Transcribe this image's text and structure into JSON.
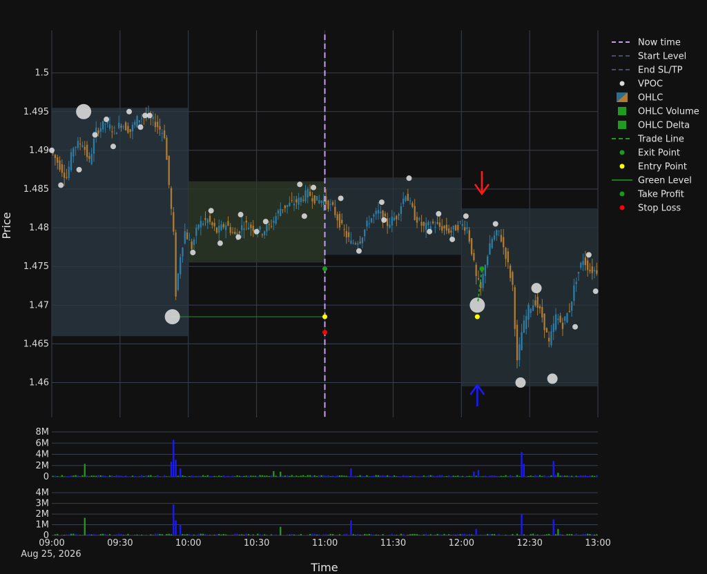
{
  "chart_data": {
    "type": "candlestick",
    "xlabel": "Time",
    "ylabel": "Price",
    "x_ticks": [
      "09:00",
      "09:30",
      "10:00",
      "10:30",
      "11:00",
      "11:30",
      "12:00",
      "12:30",
      "13:00"
    ],
    "x_date_label": "Aug 25, 2026",
    "x_range": [
      "09:00",
      "13:00"
    ],
    "price_ylim": [
      1.4555,
      1.5055
    ],
    "price_ticks": [
      "1.46",
      "1.465",
      "1.47",
      "1.475",
      "1.48",
      "1.485",
      "1.49",
      "1.495",
      "1.5"
    ],
    "volume_ticks": [
      "0",
      "2M",
      "4M",
      "6M",
      "8M"
    ],
    "volume_ylim": [
      0,
      8500000
    ],
    "delta_ticks": [
      "0",
      "1M",
      "2M",
      "3M",
      "4M"
    ],
    "delta_ylim": [
      0,
      4400000
    ],
    "now_time": "11:00",
    "legend": [
      {
        "label": "Now time",
        "kind": "dash-line",
        "color": "#c9a0f0"
      },
      {
        "label": "Start Level",
        "kind": "dash-line",
        "color": "#4b4f66"
      },
      {
        "label": "End SL/TP",
        "kind": "dash-line",
        "color": "#4b4f66"
      },
      {
        "label": "VPOC",
        "kind": "dot",
        "color": "#d9d9d9"
      },
      {
        "label": "OHLC",
        "kind": "ohlc",
        "color": "#2e6d8e"
      },
      {
        "label": "OHLC Volume",
        "kind": "square",
        "color": "#1f9b1f"
      },
      {
        "label": "OHLC Delta",
        "kind": "square",
        "color": "#1f9b1f"
      },
      {
        "label": "Trade Line",
        "kind": "dash-line",
        "color": "#1f9b1f"
      },
      {
        "label": "Exit Point",
        "kind": "dot",
        "color": "#1a9a1a"
      },
      {
        "label": "Entry Point",
        "kind": "dot",
        "color": "#ffff00"
      },
      {
        "label": "Green Level",
        "kind": "line",
        "color": "#1aa01a"
      },
      {
        "label": "Take Profit",
        "kind": "dot",
        "color": "#1a9a1a"
      },
      {
        "label": "Stop Loss",
        "kind": "dot",
        "color": "#ff0000"
      }
    ],
    "sessions": [
      {
        "start": "09:00",
        "end": "10:00",
        "low": 1.466,
        "high": 1.4955,
        "color": "#2b3a44"
      },
      {
        "start": "10:00",
        "end": "11:00",
        "low": 1.4755,
        "high": 1.486,
        "color": "#2d3b2a"
      },
      {
        "start": "11:00",
        "end": "12:00",
        "low": 1.4765,
        "high": 1.4865,
        "color": "#28343b"
      },
      {
        "start": "12:00",
        "end": "13:00",
        "low": 1.4595,
        "high": 1.4825,
        "color": "#28343b"
      }
    ],
    "price_path": [
      [
        "09:00",
        1.49
      ],
      [
        "09:04",
        1.488
      ],
      [
        "09:07",
        1.4865
      ],
      [
        "09:10",
        1.4905
      ],
      [
        "09:14",
        1.491
      ],
      [
        "09:17",
        1.4885
      ],
      [
        "09:20",
        1.4925
      ],
      [
        "09:24",
        1.4935
      ],
      [
        "09:28",
        1.4925
      ],
      [
        "09:31",
        1.4935
      ],
      [
        "09:35",
        1.4925
      ],
      [
        "09:38",
        1.494
      ],
      [
        "09:42",
        1.4945
      ],
      [
        "09:46",
        1.4935
      ],
      [
        "09:50",
        1.492
      ],
      [
        "09:52",
        1.4855
      ],
      [
        "09:54",
        1.479
      ],
      [
        "09:55",
        1.4715
      ],
      [
        "09:57",
        1.4765
      ],
      [
        "09:59",
        1.4795
      ],
      [
        "10:02",
        1.4775
      ],
      [
        "10:05",
        1.4805
      ],
      [
        "10:09",
        1.481
      ],
      [
        "10:13",
        1.4795
      ],
      [
        "10:17",
        1.4805
      ],
      [
        "10:21",
        1.479
      ],
      [
        "10:25",
        1.4805
      ],
      [
        "10:29",
        1.48
      ],
      [
        "10:33",
        1.4795
      ],
      [
        "10:37",
        1.4805
      ],
      [
        "10:41",
        1.4825
      ],
      [
        "10:45",
        1.483
      ],
      [
        "10:49",
        1.4835
      ],
      [
        "10:53",
        1.4845
      ],
      [
        "10:57",
        1.4835
      ],
      [
        "11:00",
        1.4835
      ],
      [
        "11:04",
        1.4825
      ],
      [
        "11:08",
        1.48
      ],
      [
        "11:12",
        1.478
      ],
      [
        "11:16",
        1.4785
      ],
      [
        "11:20",
        1.481
      ],
      [
        "11:24",
        1.482
      ],
      [
        "11:28",
        1.4805
      ],
      [
        "11:32",
        1.4815
      ],
      [
        "11:36",
        1.4845
      ],
      [
        "11:40",
        1.4815
      ],
      [
        "11:44",
        1.48
      ],
      [
        "11:48",
        1.4805
      ],
      [
        "11:52",
        1.48
      ],
      [
        "11:56",
        1.4795
      ],
      [
        "12:00",
        1.4805
      ],
      [
        "12:03",
        1.48
      ],
      [
        "12:05",
        1.477
      ],
      [
        "12:07",
        1.4735
      ],
      [
        "12:09",
        1.472
      ],
      [
        "12:11",
        1.4755
      ],
      [
        "12:14",
        1.4785
      ],
      [
        "12:17",
        1.4795
      ],
      [
        "12:20",
        1.4765
      ],
      [
        "12:23",
        1.4725
      ],
      [
        "12:25",
        1.4625
      ],
      [
        "12:27",
        1.4665
      ],
      [
        "12:30",
        1.4695
      ],
      [
        "12:33",
        1.4705
      ],
      [
        "12:36",
        1.4685
      ],
      [
        "12:39",
        1.465
      ],
      [
        "12:42",
        1.4685
      ],
      [
        "12:45",
        1.4675
      ],
      [
        "12:48",
        1.4695
      ],
      [
        "12:51",
        1.4735
      ],
      [
        "12:54",
        1.476
      ],
      [
        "12:57",
        1.4745
      ],
      [
        "13:00",
        1.4745
      ]
    ],
    "vpoc": [
      {
        "x": "09:00",
        "y": 1.49,
        "size": "s"
      },
      {
        "x": "09:04",
        "y": 1.4855,
        "size": "s"
      },
      {
        "x": "09:12",
        "y": 1.4875,
        "size": "s"
      },
      {
        "x": "09:14",
        "y": 1.495,
        "size": "l"
      },
      {
        "x": "09:19",
        "y": 1.492,
        "size": "s"
      },
      {
        "x": "09:24",
        "y": 1.494,
        "size": "s"
      },
      {
        "x": "09:27",
        "y": 1.4905,
        "size": "s"
      },
      {
        "x": "09:34",
        "y": 1.495,
        "size": "s"
      },
      {
        "x": "09:39",
        "y": 1.493,
        "size": "s"
      },
      {
        "x": "09:41",
        "y": 1.4945,
        "size": "s"
      },
      {
        "x": "09:43",
        "y": 1.4945,
        "size": "s"
      },
      {
        "x": "09:53",
        "y": 1.4685,
        "size": "l"
      },
      {
        "x": "10:02",
        "y": 1.4768,
        "size": "s"
      },
      {
        "x": "10:10",
        "y": 1.4822,
        "size": "s"
      },
      {
        "x": "10:14",
        "y": 1.478,
        "size": "s"
      },
      {
        "x": "10:22",
        "y": 1.4788,
        "size": "s"
      },
      {
        "x": "10:23",
        "y": 1.4817,
        "size": "s"
      },
      {
        "x": "10:30",
        "y": 1.4795,
        "size": "s"
      },
      {
        "x": "10:34",
        "y": 1.4808,
        "size": "s"
      },
      {
        "x": "10:49",
        "y": 1.4856,
        "size": "s"
      },
      {
        "x": "10:51",
        "y": 1.4815,
        "size": "s"
      },
      {
        "x": "10:55",
        "y": 1.4852,
        "size": "s"
      },
      {
        "x": "11:07",
        "y": 1.4838,
        "size": "s"
      },
      {
        "x": "11:15",
        "y": 1.477,
        "size": "s"
      },
      {
        "x": "11:25",
        "y": 1.4833,
        "size": "s"
      },
      {
        "x": "11:26",
        "y": 1.481,
        "size": "s"
      },
      {
        "x": "11:37",
        "y": 1.4864,
        "size": "s"
      },
      {
        "x": "11:46",
        "y": 1.4795,
        "size": "s"
      },
      {
        "x": "11:50",
        "y": 1.4818,
        "size": "s"
      },
      {
        "x": "11:56",
        "y": 1.4785,
        "size": "s"
      },
      {
        "x": "12:02",
        "y": 1.4815,
        "size": "s"
      },
      {
        "x": "12:07",
        "y": 1.47,
        "size": "l"
      },
      {
        "x": "12:15",
        "y": 1.4805,
        "size": "s"
      },
      {
        "x": "12:26",
        "y": 1.46,
        "size": "m"
      },
      {
        "x": "12:33",
        "y": 1.4722,
        "size": "m"
      },
      {
        "x": "12:40",
        "y": 1.4605,
        "size": "m"
      },
      {
        "x": "12:50",
        "y": 1.4672,
        "size": "s"
      },
      {
        "x": "12:56",
        "y": 1.4765,
        "size": "s"
      },
      {
        "x": "12:59",
        "y": 1.4718,
        "size": "s"
      }
    ],
    "green_level": {
      "x_start": "09:53",
      "x_end": "11:00",
      "y": 1.4685
    },
    "trade_points": [
      {
        "kind": "take-profit",
        "x": "11:00",
        "y": 1.4747,
        "color": "#1a9a1a"
      },
      {
        "kind": "entry",
        "x": "11:00",
        "y": 1.4685,
        "color": "#ffff00"
      },
      {
        "kind": "stop-loss",
        "x": "11:00",
        "y": 1.4665,
        "color": "#ff0000"
      },
      {
        "kind": "exit",
        "x": "12:09",
        "y": 1.4747,
        "color": "#1a9a1a"
      },
      {
        "kind": "entry",
        "x": "12:07",
        "y": 1.4685,
        "color": "#ffff00"
      }
    ],
    "arrows": [
      {
        "direction": "down",
        "x": "12:09",
        "color": "#ff1a1a"
      },
      {
        "direction": "up",
        "x": "12:07",
        "color": "#1a1aff"
      }
    ],
    "volume_spikes": [
      {
        "x": "09:14",
        "v": 2300000,
        "color": "#1f9b1f"
      },
      {
        "x": "09:52",
        "v": 2700000,
        "color": "#1a1aff"
      },
      {
        "x": "09:53",
        "v": 6600000,
        "color": "#1a1aff"
      },
      {
        "x": "09:54",
        "v": 3000000,
        "color": "#1a1aff"
      },
      {
        "x": "09:56",
        "v": 1500000,
        "color": "#1a1aff"
      },
      {
        "x": "10:37",
        "v": 1000000,
        "color": "#1f9b1f"
      },
      {
        "x": "10:40",
        "v": 900000,
        "color": "#1f9b1f"
      },
      {
        "x": "11:11",
        "v": 1500000,
        "color": "#1a1aff"
      },
      {
        "x": "12:05",
        "v": 900000,
        "color": "#1a1aff"
      },
      {
        "x": "12:07",
        "v": 1200000,
        "color": "#1a1aff"
      },
      {
        "x": "12:26",
        "v": 4400000,
        "color": "#1a1aff"
      },
      {
        "x": "12:27",
        "v": 2300000,
        "color": "#1a1aff"
      },
      {
        "x": "12:40",
        "v": 2800000,
        "color": "#1a1aff"
      },
      {
        "x": "12:42",
        "v": 700000,
        "color": "#1f9b1f"
      }
    ],
    "delta_spikes": [
      {
        "x": "09:14",
        "v": 1650000,
        "color": "#1f9b1f"
      },
      {
        "x": "09:53",
        "v": 2900000,
        "color": "#1a1aff"
      },
      {
        "x": "09:54",
        "v": 1400000,
        "color": "#1a1aff"
      },
      {
        "x": "09:56",
        "v": 1000000,
        "color": "#1a1aff"
      },
      {
        "x": "10:40",
        "v": 800000,
        "color": "#1f9b1f"
      },
      {
        "x": "11:11",
        "v": 1400000,
        "color": "#1a1aff"
      },
      {
        "x": "12:06",
        "v": 600000,
        "color": "#1a1aff"
      },
      {
        "x": "12:26",
        "v": 2000000,
        "color": "#1a1aff"
      },
      {
        "x": "12:40",
        "v": 1500000,
        "color": "#1a1aff"
      },
      {
        "x": "12:42",
        "v": 600000,
        "color": "#1f9b1f"
      }
    ]
  }
}
